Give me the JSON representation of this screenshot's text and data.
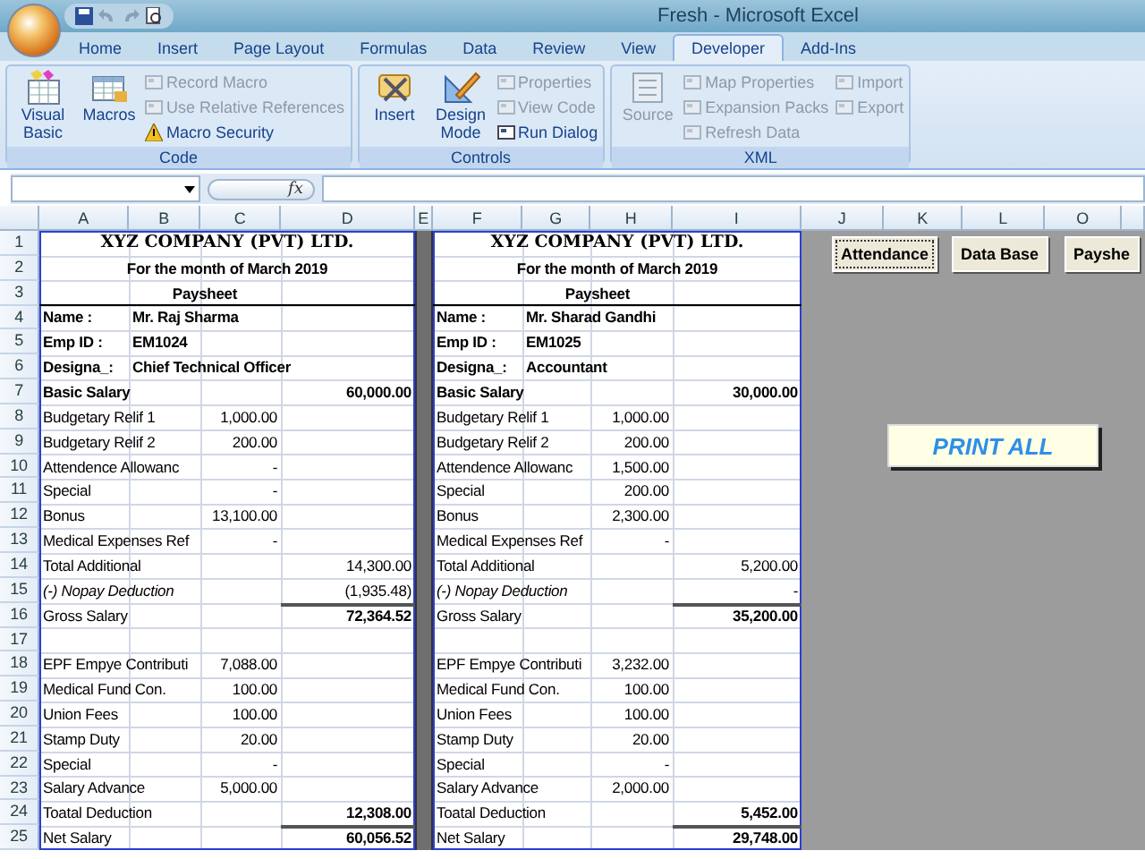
{
  "window": {
    "title": "Fresh - Microsoft Excel"
  },
  "ribbon_tabs": [
    {
      "label": "Home",
      "selected": false
    },
    {
      "label": "Insert",
      "selected": false
    },
    {
      "label": "Page Layout",
      "selected": false
    },
    {
      "label": "Formulas",
      "selected": false
    },
    {
      "label": "Data",
      "selected": false
    },
    {
      "label": "Review",
      "selected": false
    },
    {
      "label": "View",
      "selected": false
    },
    {
      "label": "Developer",
      "selected": true
    },
    {
      "label": "Add-Ins",
      "selected": false
    }
  ],
  "ribbon_groups": [
    {
      "name": "Code",
      "large": [
        {
          "label": "Visual Basic",
          "disabled": false
        },
        {
          "label": "Macros",
          "disabled": false
        }
      ],
      "small": [
        {
          "label": "Record Macro",
          "disabled": true
        },
        {
          "label": "Use Relative References",
          "disabled": true
        },
        {
          "label": "Macro Security",
          "disabled": false
        }
      ]
    },
    {
      "name": "Controls",
      "large": [
        {
          "label": "Insert",
          "disabled": false
        },
        {
          "label": "Design Mode",
          "disabled": false
        }
      ],
      "small": [
        {
          "label": "Properties",
          "disabled": true
        },
        {
          "label": "View Code",
          "disabled": true
        },
        {
          "label": "Run Dialog",
          "disabled": false
        }
      ]
    },
    {
      "name": "XML",
      "large": [
        {
          "label": "Source",
          "disabled": true
        }
      ],
      "small": [
        {
          "label": "Map Properties",
          "disabled": true
        },
        {
          "label": "Expansion Packs",
          "disabled": true
        },
        {
          "label": "Refresh Data",
          "disabled": true
        },
        {
          "label": "Import",
          "disabled": true
        },
        {
          "label": "Export",
          "disabled": true
        }
      ]
    }
  ],
  "formula_bar": {
    "function_label": "fx"
  },
  "columns": [
    "A",
    "B",
    "C",
    "D",
    "E",
    "F",
    "G",
    "H",
    "I",
    "J",
    "K",
    "L",
    "O"
  ],
  "row_numbers": [
    "1",
    "2",
    "3",
    "4",
    "5",
    "6",
    "7",
    "8",
    "9",
    "10",
    "11",
    "12",
    "13",
    "14",
    "15",
    "16",
    "17",
    "18",
    "19",
    "20",
    "21",
    "22",
    "23",
    "24",
    "25"
  ],
  "paysheets": [
    {
      "rows": [
        {
          "kind": "title",
          "text": "XYZ COMPANY (PVT) LTD."
        },
        {
          "kind": "period",
          "text": "For the month of March 2019"
        },
        {
          "kind": "heading",
          "text": "Paysheet"
        },
        {
          "kind": "field",
          "label": "Name  :",
          "value": "Mr. Raj Sharma"
        },
        {
          "kind": "field",
          "label": "Emp ID :",
          "value": "EM1024"
        },
        {
          "kind": "field",
          "label": "Designa_:",
          "value": "Chief Technical Officer"
        },
        {
          "kind": "basic",
          "label": "Basic Salary",
          "total": "60,000.00"
        },
        {
          "kind": "line",
          "label": "Budgetary Relif 1",
          "amount": "1,000.00"
        },
        {
          "kind": "line",
          "label": "Budgetary Relif 2",
          "amount": "200.00"
        },
        {
          "kind": "line",
          "label": "Attendence Allowanc",
          "amount": "-"
        },
        {
          "kind": "line",
          "label": "Special",
          "amount": "-"
        },
        {
          "kind": "line",
          "label": "Bonus",
          "amount": "13,100.00"
        },
        {
          "kind": "line",
          "label": "Medical Expenses Ref",
          "amount": "-"
        },
        {
          "kind": "line",
          "label": "Total Additional",
          "total": "14,300.00"
        },
        {
          "kind": "italic",
          "label": "(-) Nopay Deduction",
          "total": "(1,935.48)"
        },
        {
          "kind": "ruled",
          "label": "Gross Salary",
          "total": "72,364.52"
        },
        {
          "kind": "blank"
        },
        {
          "kind": "line",
          "label": "EPF Empye Contributi",
          "amount": "7,088.00"
        },
        {
          "kind": "line",
          "label": "Medical Fund Con.",
          "amount": "100.00"
        },
        {
          "kind": "line",
          "label": "Union Fees",
          "amount": "100.00"
        },
        {
          "kind": "line",
          "label": "Stamp Duty",
          "amount": "20.00"
        },
        {
          "kind": "line",
          "label": "Special",
          "amount": "-"
        },
        {
          "kind": "line",
          "label": "Salary Advance",
          "amount": "5,000.00"
        },
        {
          "kind": "bold",
          "label": "Toatal Deduction",
          "total": "12,308.00"
        },
        {
          "kind": "ruled",
          "label": "Net Salary",
          "total": "60,056.52"
        }
      ]
    },
    {
      "rows": [
        {
          "kind": "title",
          "text": "XYZ COMPANY (PVT) LTD."
        },
        {
          "kind": "period",
          "text": "For the month of March 2019"
        },
        {
          "kind": "heading",
          "text": "Paysheet"
        },
        {
          "kind": "field",
          "label": "Name  :",
          "value": "Mr. Sharad Gandhi"
        },
        {
          "kind": "field",
          "label": "Emp ID :",
          "value": "EM1025"
        },
        {
          "kind": "field",
          "label": "Designa_:",
          "value": "Accountant"
        },
        {
          "kind": "basic",
          "label": "Basic Salary",
          "total": "30,000.00"
        },
        {
          "kind": "line",
          "label": "Budgetary Relif 1",
          "amount": "1,000.00"
        },
        {
          "kind": "line",
          "label": "Budgetary Relif 2",
          "amount": "200.00"
        },
        {
          "kind": "line",
          "label": "Attendence Allowanc",
          "amount": "1,500.00"
        },
        {
          "kind": "line",
          "label": "Special",
          "amount": "200.00"
        },
        {
          "kind": "line",
          "label": "Bonus",
          "amount": "2,300.00"
        },
        {
          "kind": "line",
          "label": "Medical Expenses Ref",
          "amount": "-"
        },
        {
          "kind": "line",
          "label": "Total Additional",
          "total": "5,200.00"
        },
        {
          "kind": "italic",
          "label": "(-) Nopay Deduction",
          "total": "-"
        },
        {
          "kind": "ruled",
          "label": "Gross Salary",
          "total": "35,200.00"
        },
        {
          "kind": "blank"
        },
        {
          "kind": "line",
          "label": "EPF Empye Contributi",
          "amount": "3,232.00"
        },
        {
          "kind": "line",
          "label": "Medical Fund Con.",
          "amount": "100.00"
        },
        {
          "kind": "line",
          "label": "Union Fees",
          "amount": "100.00"
        },
        {
          "kind": "line",
          "label": "Stamp Duty",
          "amount": "20.00"
        },
        {
          "kind": "line",
          "label": "Special",
          "amount": "-"
        },
        {
          "kind": "line",
          "label": "Salary Advance",
          "amount": "2,000.00"
        },
        {
          "kind": "bold",
          "label": "Toatal Deduction",
          "total": "5,452.00"
        },
        {
          "kind": "ruled",
          "label": "Net Salary",
          "total": "29,748.00"
        }
      ]
    }
  ],
  "sheet_buttons": [
    {
      "label": "Attendance",
      "focused": true
    },
    {
      "label": "Data Base",
      "focused": false
    },
    {
      "label": "Payshe",
      "focused": false
    }
  ],
  "print_button": {
    "label": "PRINT ALL"
  }
}
